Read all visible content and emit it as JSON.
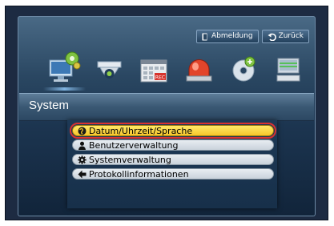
{
  "topbar": {
    "logout_label": "Abmeldung",
    "back_label": "Zurück"
  },
  "section_icons": [
    {
      "name": "system-settings-icon",
      "selected": true
    },
    {
      "name": "camera-icon",
      "selected": false
    },
    {
      "name": "recording-icon",
      "selected": false
    },
    {
      "name": "alarm-event-icon",
      "selected": false
    },
    {
      "name": "backup-disc-icon",
      "selected": false
    },
    {
      "name": "network-icon",
      "selected": false
    }
  ],
  "page": {
    "title": "System"
  },
  "menu": {
    "items": [
      {
        "label": "Datum/Uhrzeit/Sprache",
        "icon": "globe-icon",
        "active": true
      },
      {
        "label": "Benutzerverwaltung",
        "icon": "user-icon",
        "active": false
      },
      {
        "label": "Systemverwaltung",
        "icon": "gear-icon",
        "active": false
      },
      {
        "label": "Protokollinformationen",
        "icon": "log-info-icon",
        "active": false
      }
    ]
  },
  "colors": {
    "highlight": "#f7c52a",
    "selection_outline": "#d93232",
    "panel": "#1d3956"
  }
}
